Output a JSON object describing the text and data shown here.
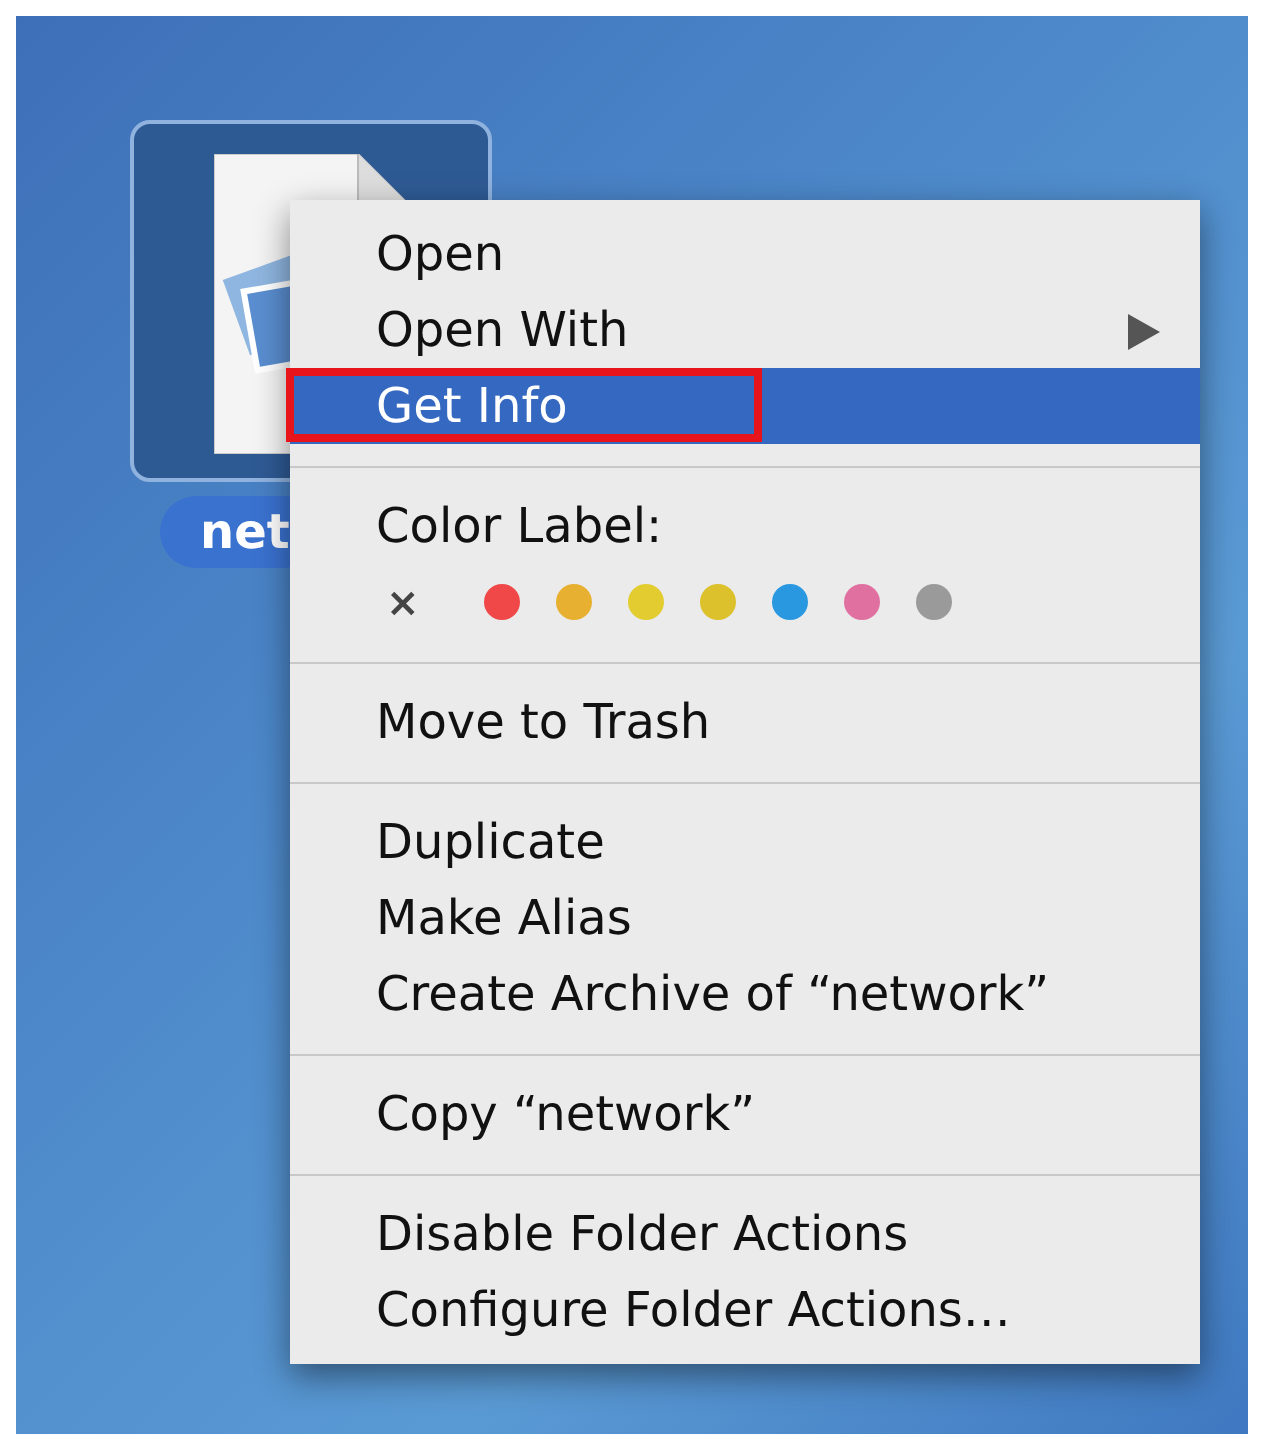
{
  "desktop_icon": {
    "label": "net",
    "selected": true
  },
  "context_menu": {
    "items": [
      {
        "kind": "item",
        "label": "Open",
        "submenu": false,
        "selected": false,
        "annotated": false
      },
      {
        "kind": "item",
        "label": "Open With",
        "submenu": true,
        "selected": false,
        "annotated": false
      },
      {
        "kind": "item",
        "label": "Get Info",
        "submenu": false,
        "selected": true,
        "annotated": true
      },
      {
        "kind": "separator"
      },
      {
        "kind": "header",
        "label": "Color Label:"
      },
      {
        "kind": "colors",
        "clear": "×",
        "swatches": [
          {
            "color": "#f04848"
          },
          {
            "color": "#e8b030"
          },
          {
            "color": "#e2cc30"
          },
          {
            "color": "#dcc02c"
          },
          {
            "color": "#2a98e0"
          },
          {
            "color": "#e070a0"
          },
          {
            "color": "#9a9a9a"
          }
        ]
      },
      {
        "kind": "separator"
      },
      {
        "kind": "item",
        "label": "Move to Trash",
        "submenu": false,
        "selected": false,
        "annotated": false
      },
      {
        "kind": "separator"
      },
      {
        "kind": "item",
        "label": "Duplicate",
        "submenu": false,
        "selected": false,
        "annotated": false
      },
      {
        "kind": "item",
        "label": "Make Alias",
        "submenu": false,
        "selected": false,
        "annotated": false
      },
      {
        "kind": "item",
        "label": "Create Archive of “network”",
        "submenu": false,
        "selected": false,
        "annotated": false
      },
      {
        "kind": "separator"
      },
      {
        "kind": "item",
        "label": "Copy “network”",
        "submenu": false,
        "selected": false,
        "annotated": false
      },
      {
        "kind": "separator"
      },
      {
        "kind": "item",
        "label": "Disable Folder Actions",
        "submenu": false,
        "selected": false,
        "annotated": false
      },
      {
        "kind": "item",
        "label": "Configure Folder Actions…",
        "submenu": false,
        "selected": false,
        "annotated": false
      }
    ]
  }
}
